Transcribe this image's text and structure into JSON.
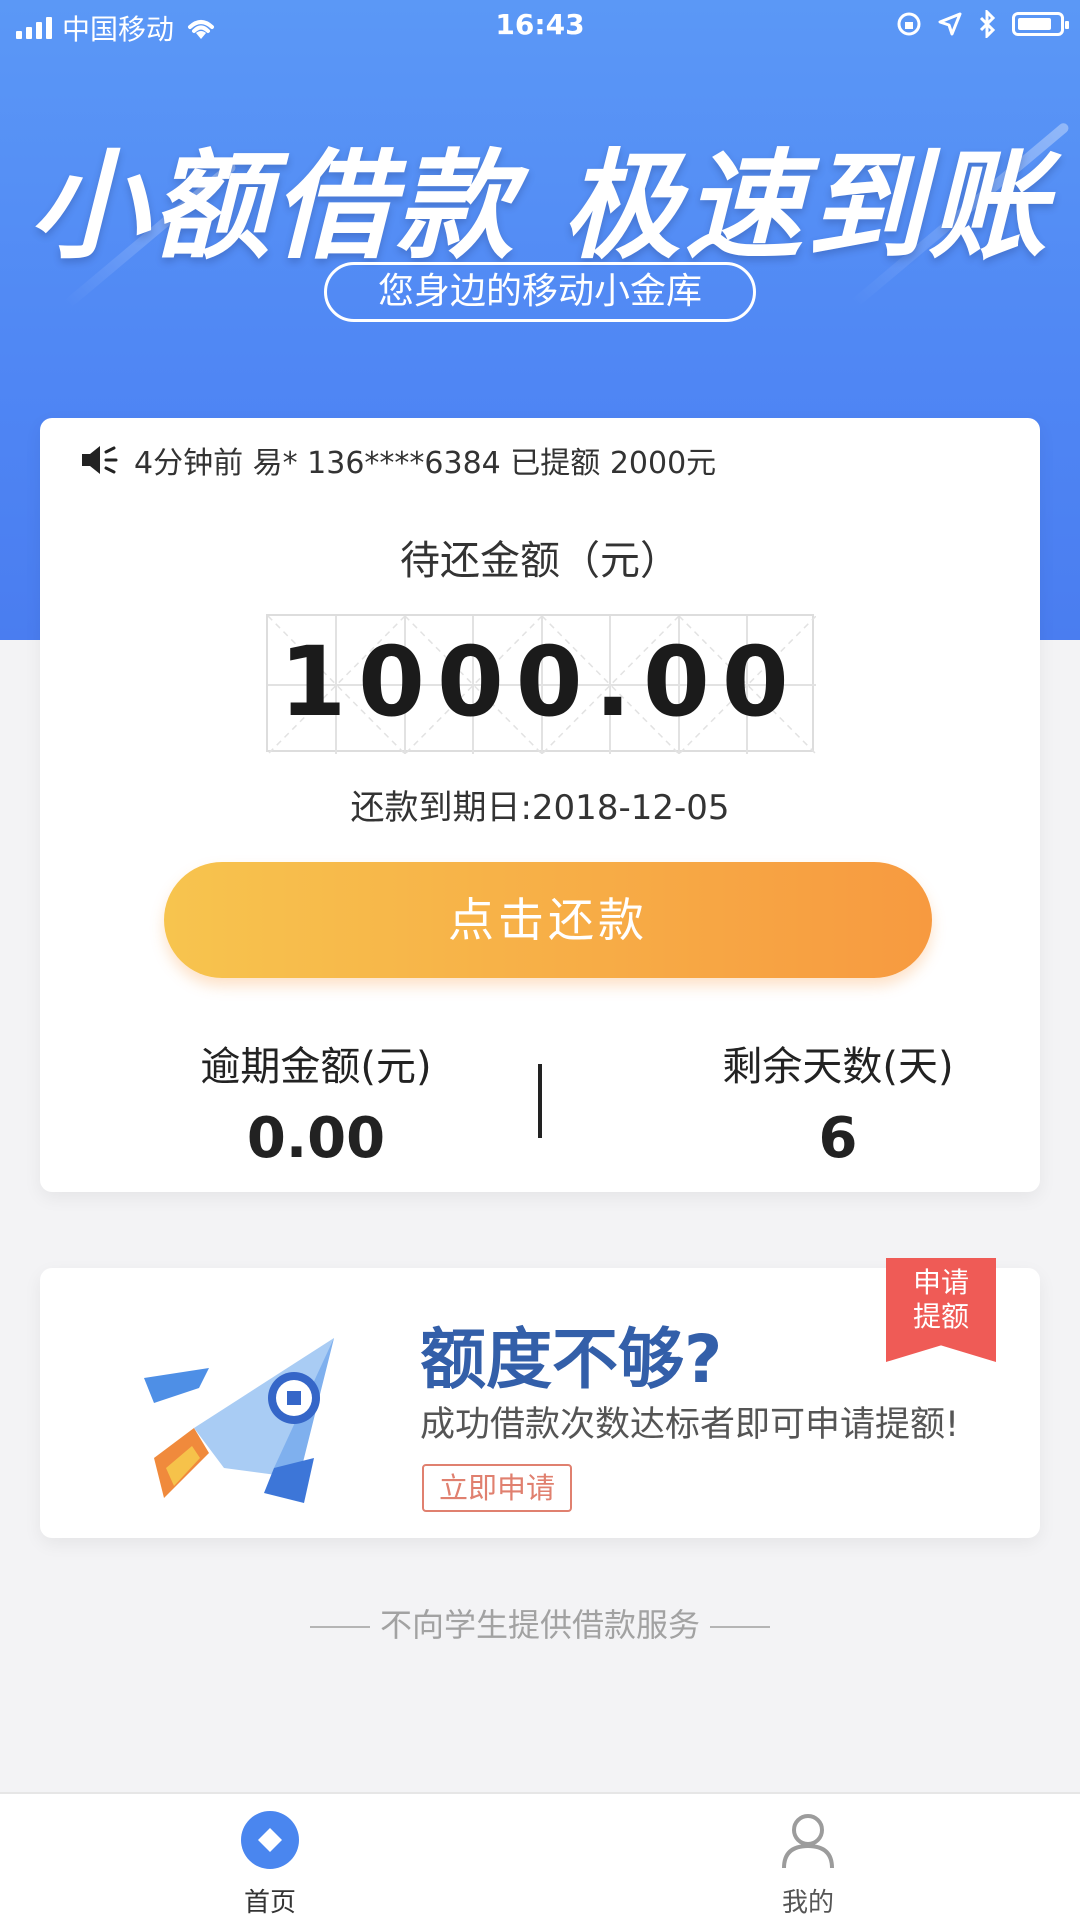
{
  "status_bar": {
    "carrier": "中国移动",
    "time": "16:43"
  },
  "hero": {
    "title": "小额借款 极速到账",
    "subtitle": "您身边的移动小金库"
  },
  "card": {
    "notice": "4分钟前 易* 136****6384 已提额 2000元",
    "due_label": "待还金额（元）",
    "amount": "1000.00",
    "due_date": "还款到期日:2018-12-05",
    "repay_button": "点击还款",
    "overdue_label": "逾期金额(元)",
    "overdue_value": "0.00",
    "days_label": "剩余天数(天)",
    "days_value": "6"
  },
  "promo": {
    "title": "额度不够?",
    "subtitle": "成功借款次数达标者即可申请提额!",
    "apply_button": "立即申请",
    "ribbon": "申请提额"
  },
  "footer_note": "不向学生提供借款服务",
  "tabbar": {
    "home": "首页",
    "me": "我的"
  },
  "colors": {
    "hero_blue": "#5b98f6",
    "button_orange": "#f79a40",
    "promo_blue": "#335fa9",
    "ribbon_red": "#ef5b56"
  }
}
